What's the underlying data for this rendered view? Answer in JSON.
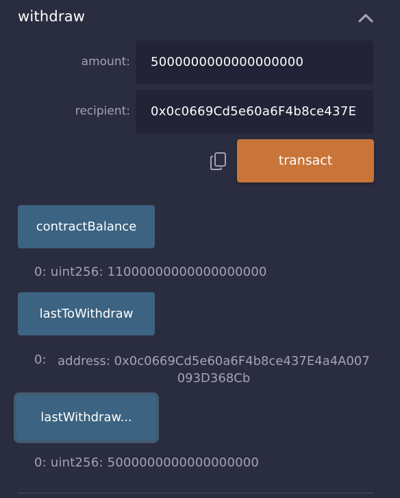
{
  "function": {
    "name": "withdraw"
  },
  "params": {
    "amount": {
      "label": "amount:",
      "value": "5000000000000000000"
    },
    "recipient": {
      "label": "recipient:",
      "value": "0x0c0669Cd5e60a6F4b8ce437E"
    }
  },
  "transact_label": "transact",
  "calls": [
    {
      "button": "contractBalance",
      "index": "0:",
      "result": "uint256: 11000000000000000000"
    },
    {
      "button": "lastToWithdraw",
      "index": "0:",
      "result": "address: 0x0c0669Cd5e60a6F4b8ce437E4a4A007093D368Cb"
    },
    {
      "button": "lastWithdraw...",
      "index": "0:",
      "result": "uint256: 5000000000000000000"
    }
  ],
  "icons": {
    "collapse": "chevron-up-icon",
    "copy": "copy-icon"
  },
  "colors": {
    "background": "#2a2c3f",
    "input_bg": "#222336",
    "transact": "#c97539",
    "call": "#3c6381",
    "label": "#a2a3bd"
  }
}
